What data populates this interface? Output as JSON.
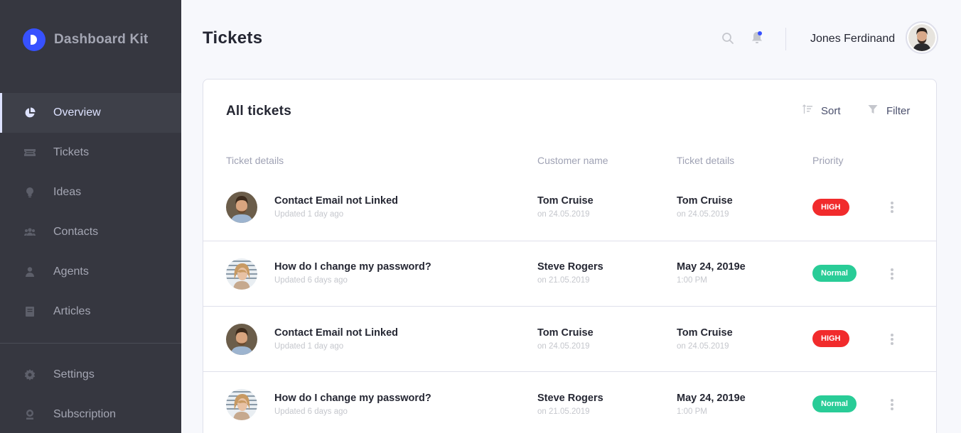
{
  "brand": {
    "name": "Dashboard Kit",
    "color": "#3751ff"
  },
  "sidebar": {
    "items": [
      {
        "label": "Overview",
        "icon": "pie-chart-icon",
        "active": true
      },
      {
        "label": "Tickets",
        "icon": "ticket-icon"
      },
      {
        "label": "Ideas",
        "icon": "lightbulb-icon"
      },
      {
        "label": "Contacts",
        "icon": "contacts-icon"
      },
      {
        "label": "Agents",
        "icon": "agent-icon"
      },
      {
        "label": "Articles",
        "icon": "book-icon"
      }
    ],
    "bottom_items": [
      {
        "label": "Settings",
        "icon": "gear-icon"
      },
      {
        "label": "Subscription",
        "icon": "award-icon"
      }
    ]
  },
  "header": {
    "title": "Tickets",
    "user_name": "Jones Ferdinand",
    "icons": [
      "search-icon",
      "bell-icon"
    ]
  },
  "card": {
    "title": "All tickets",
    "sort_label": "Sort",
    "filter_label": "Filter",
    "columns": [
      "Ticket details",
      "Customer name",
      "Ticket details",
      "Priority"
    ]
  },
  "tickets": [
    {
      "title": "Contact Email not Linked",
      "updated": "Updated 1 day ago",
      "customer": "Tom Cruise",
      "customer_date": "on 24.05.2019",
      "detail": "Tom Cruise",
      "detail_sub": "on 24.05.2019",
      "priority": "HIGH",
      "priority_color": "#f12b2c"
    },
    {
      "title": "How do I change my password?",
      "updated": "Updated 6 days ago",
      "customer": "Steve Rogers",
      "customer_date": "on 21.05.2019",
      "detail": "May 24, 2019e",
      "detail_sub": "1:00 PM",
      "priority": "Normal",
      "priority_color": "#29cc97"
    },
    {
      "title": "Contact Email not Linked",
      "updated": "Updated 1 day ago",
      "customer": "Tom Cruise",
      "customer_date": "on 24.05.2019",
      "detail": "Tom Cruise",
      "detail_sub": "on 24.05.2019",
      "priority": "HIGH",
      "priority_color": "#f12b2c"
    },
    {
      "title": "How do I change my password?",
      "updated": "Updated 6 days ago",
      "customer": "Steve Rogers",
      "customer_date": "on 21.05.2019",
      "detail": "May 24, 2019e",
      "detail_sub": "1:00 PM",
      "priority": "Normal",
      "priority_color": "#29cc97"
    }
  ]
}
